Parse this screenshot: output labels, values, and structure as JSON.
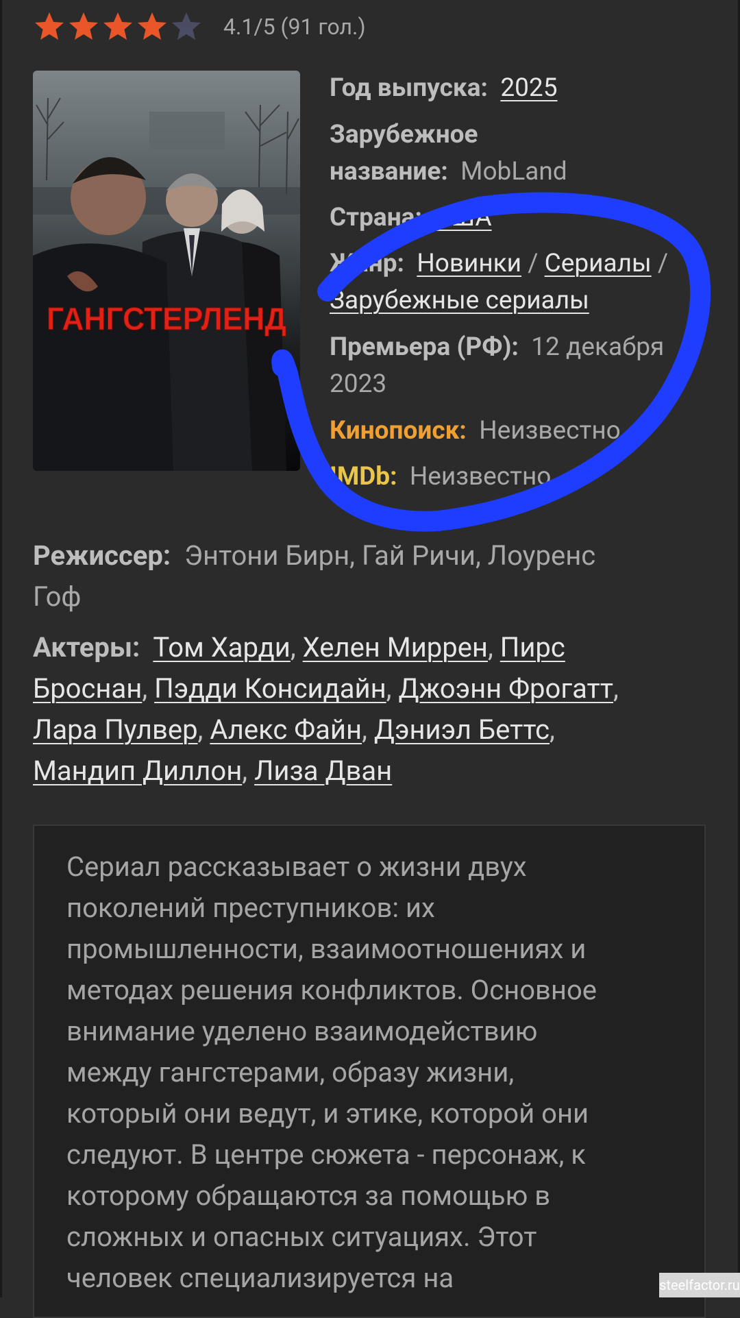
{
  "rating": {
    "value": 4.1,
    "max": 5,
    "stars_filled": 4,
    "text": "4.1/5 (91 гол.)"
  },
  "poster": {
    "title_text": "ГАНГСТЕРЛЕНД"
  },
  "info": {
    "year_label": "Год выпуска:",
    "year_value": "2025",
    "foreign_label_line1": "Зарубежное",
    "foreign_label_line2": "название:",
    "foreign_value": "MobLand",
    "country_label": "Страна:",
    "country_value": "США",
    "genre_label": "Жанр:",
    "genre_links": [
      "Новинки",
      "Сериалы",
      "Зарубежные сериалы"
    ],
    "genre_separator": " / ",
    "premiere_label": "Премьера (РФ):",
    "premiere_value_line1": "12 декабря",
    "premiere_value_line2": "2023",
    "kinopoisk_label": "Кинопоиск:",
    "kinopoisk_value": "Неизвестно",
    "imdb_label": "IMDb:",
    "imdb_value": "Неизвестно"
  },
  "director": {
    "label": "Режиссер:",
    "value_line1": "Энтони Бирн, Гай Ричи, Лоуренс",
    "value_line2": "Гоф"
  },
  "actors": {
    "label": "Актеры:",
    "names": [
      "Том Харди",
      "Хелен Миррен",
      "Пирс Броснан",
      "Пэдди Консидайн",
      "Джоэнн Фрогатт",
      "Лара Пулвер",
      "Алекс Файн",
      "Дэниэл Беттс",
      "Мандип Диллон",
      "Лиза Дван"
    ],
    "pirs_line1": "Пирс",
    "pirs_line2": "Броснан",
    "separator": ","
  },
  "description": {
    "lines": [
      "Сериал рассказывает о жизни двух",
      "поколений преступников: их",
      "промышленности, взаимоотношениях и",
      "методах решения конфликтов. Основное",
      "внимание уделено взаимодействию",
      "между гангстерами, образу жизни,",
      "который они ведут, и этике, которой они",
      "следуют. В центре сюжета - персонаж, к",
      "которому обращаются за помощью в",
      "сложных и опасных ситуациях. Этот",
      "человек специализируется на"
    ]
  },
  "watermark": "steelfactor.ru",
  "colors": {
    "background": "#2b2b2b",
    "star": "#e8562a",
    "kinopoisk": "#f0a033",
    "imdb": "#e9c64a",
    "scribble": "#1f3dff"
  }
}
